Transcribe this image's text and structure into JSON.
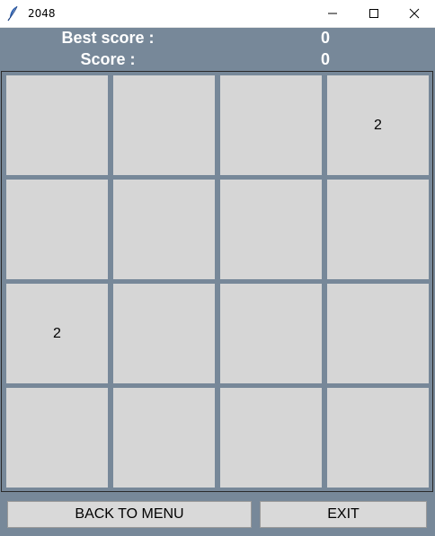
{
  "window": {
    "title": "2048",
    "app_icon": "feather-icon",
    "controls": [
      "minimize-icon",
      "maximize-icon",
      "close-icon"
    ]
  },
  "header": {
    "best_label": "Best score :",
    "best_value": "0",
    "score_label": "Score :",
    "score_value": "0"
  },
  "board": {
    "cells": [
      [
        "",
        "",
        "",
        "2"
      ],
      [
        "",
        "",
        "",
        ""
      ],
      [
        "2",
        "",
        "",
        ""
      ],
      [
        "",
        "",
        "",
        ""
      ]
    ]
  },
  "buttons": {
    "back_label": "BACK TO MENU",
    "exit_label": "EXIT"
  },
  "colors": {
    "background": "#778899",
    "tile": "#d6d6d6",
    "header_text": "#ffffff"
  }
}
